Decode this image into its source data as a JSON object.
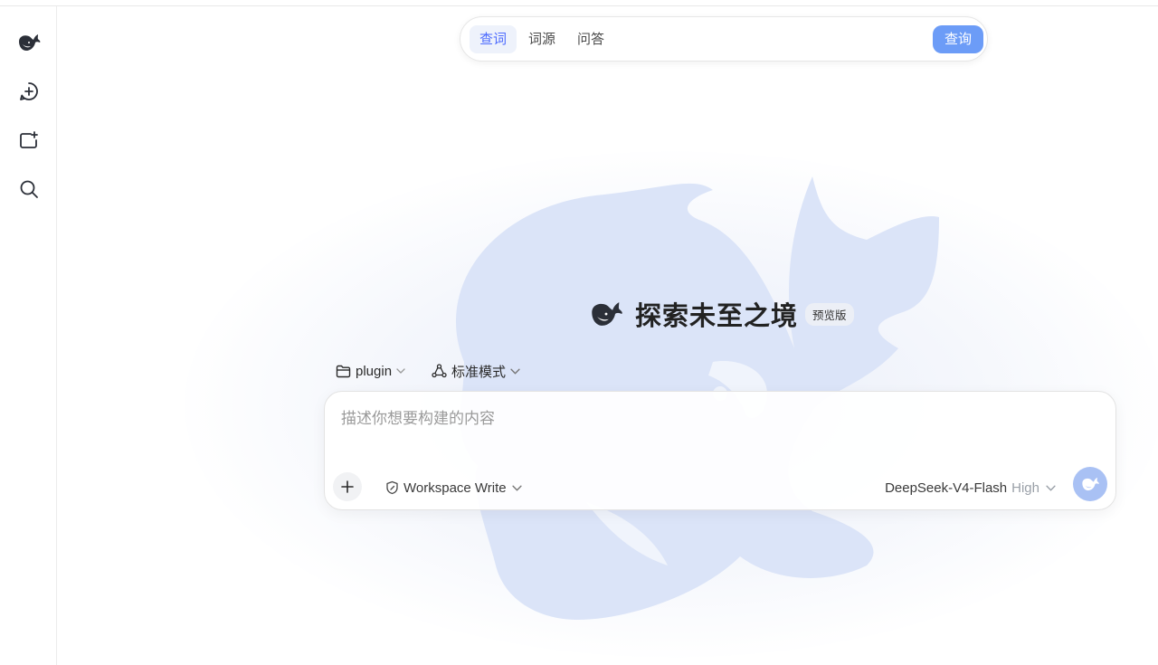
{
  "dictionary": {
    "tabs": [
      {
        "label": "查词",
        "active": true
      },
      {
        "label": "词源",
        "active": false
      },
      {
        "label": "问答",
        "active": false
      }
    ],
    "search_label": "查询"
  },
  "sidebar": {
    "icons": [
      "whale-logo-icon",
      "new-chat-icon",
      "new-project-icon",
      "search-icon"
    ]
  },
  "hero": {
    "title": "探索未至之境",
    "badge": "预览版"
  },
  "toolbar": {
    "project": "plugin",
    "mode": "标准模式"
  },
  "composer": {
    "placeholder": "描述你想要构建的内容",
    "permission": "Workspace Write",
    "model": "DeepSeek-V4-Flash",
    "effort": "High"
  },
  "colors": {
    "accent": "#4d6bfe",
    "search_button": "#6c9cf7",
    "send_button": "#a9c1f4",
    "whale_watermark": "#dbe4f8"
  }
}
